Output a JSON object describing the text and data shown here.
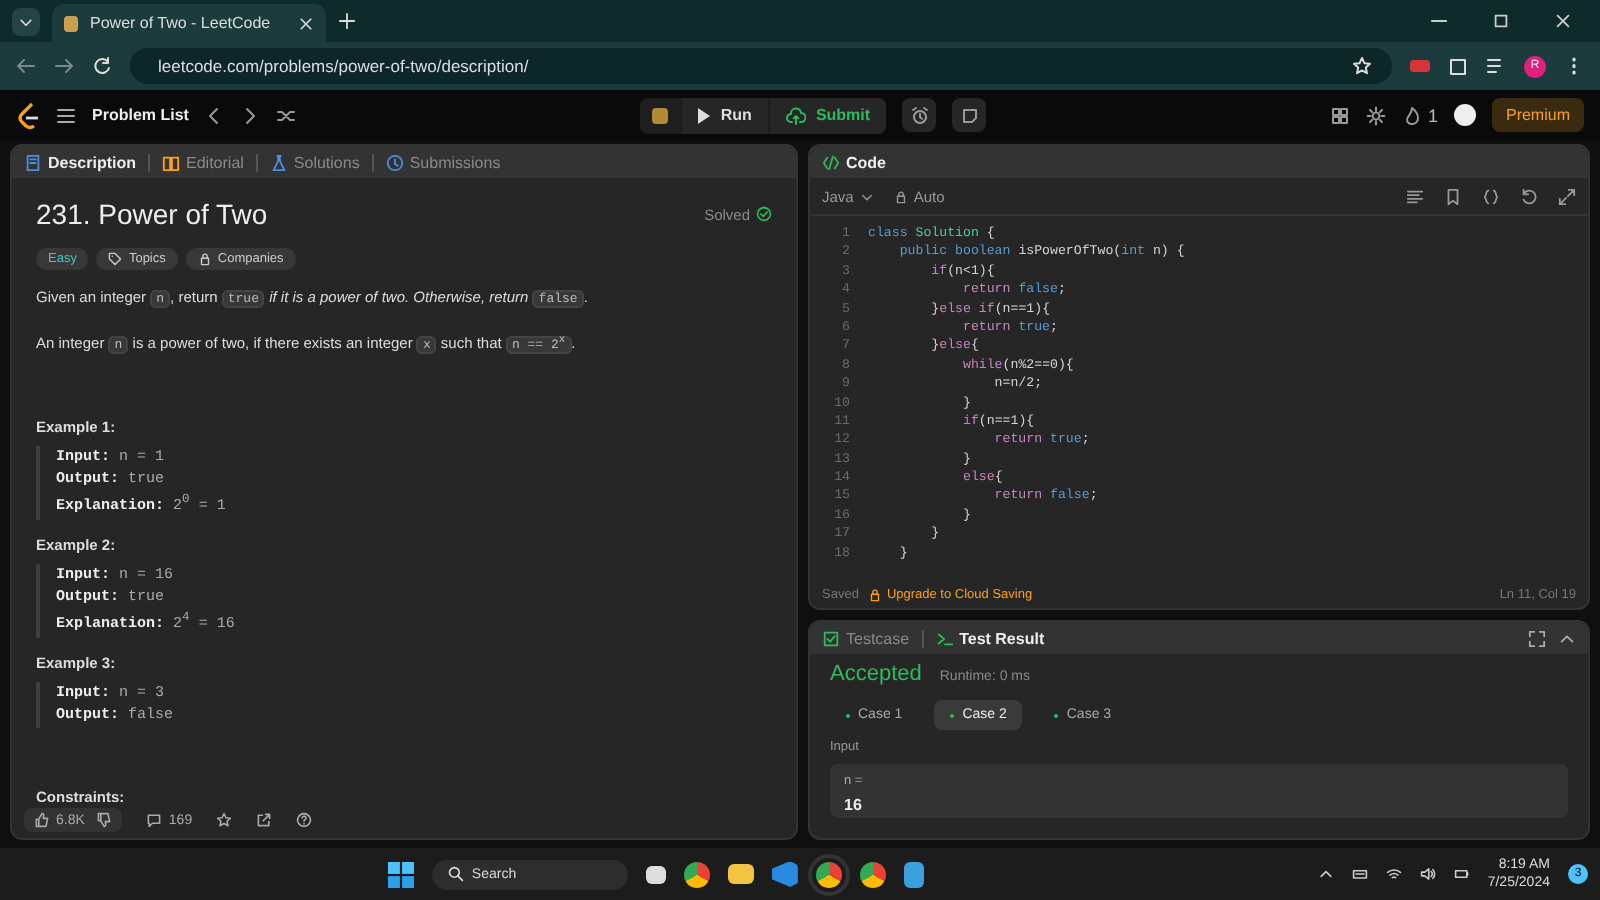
{
  "browser": {
    "tab_title": "Power of Two - LeetCode",
    "url": "leetcode.com/problems/power-of-two/description/",
    "profile_initial": "R"
  },
  "nav": {
    "problem_list": "Problem List",
    "run": "Run",
    "submit": "Submit",
    "streak": "1",
    "premium": "Premium"
  },
  "description_tabs": [
    {
      "label": "Description",
      "selected": true
    },
    {
      "label": "Editorial",
      "selected": false
    },
    {
      "label": "Solutions",
      "selected": false
    },
    {
      "label": "Submissions",
      "selected": false
    }
  ],
  "problem": {
    "title": "231. Power of Two",
    "status": "Solved",
    "difficulty": "Easy",
    "tags": [
      "Topics",
      "Companies"
    ],
    "paragraphs": [
      [
        {
          "kind": "text",
          "text": "Given an integer "
        },
        {
          "kind": "code",
          "text": "n"
        },
        {
          "kind": "text",
          "text": ", return "
        },
        {
          "kind": "code",
          "text": "true"
        },
        {
          "kind": "italic",
          "text": " if it is a power of two. Otherwise, return "
        },
        {
          "kind": "code",
          "text": "false"
        },
        {
          "kind": "text",
          "text": "."
        }
      ],
      [
        {
          "kind": "text",
          "text": "An integer "
        },
        {
          "kind": "code",
          "text": "n"
        },
        {
          "kind": "text",
          "text": " is a power of two, if there exists an integer "
        },
        {
          "kind": "code",
          "text": "x"
        },
        {
          "kind": "text",
          "text": " such that "
        },
        {
          "kind": "code",
          "text": "n == 2$^{x}$"
        },
        {
          "kind": "text",
          "text": "."
        }
      ]
    ],
    "examples": [
      {
        "title": "Example 1:",
        "lines": [
          {
            "label": "Input:",
            "value": "n = 1"
          },
          {
            "label": "Output:",
            "value": "true"
          },
          {
            "label": "Explanation:",
            "value": "2$^{0}$ = 1"
          }
        ]
      },
      {
        "title": "Example 2:",
        "lines": [
          {
            "label": "Input:",
            "value": "n = 16"
          },
          {
            "label": "Output:",
            "value": "true"
          },
          {
            "label": "Explanation:",
            "value": "2$^{4}$ = 16"
          }
        ]
      },
      {
        "title": "Example 3:",
        "lines": [
          {
            "label": "Input:",
            "value": "n = 3"
          },
          {
            "label": "Output:",
            "value": "false"
          }
        ]
      }
    ],
    "constraints_title": "Constraints:",
    "likes": "6.8K",
    "comments": "169"
  },
  "code_panel": {
    "title": "Code",
    "language": "Java",
    "mode": "Auto",
    "saved": "Saved",
    "upgrade": "Upgrade to Cloud Saving",
    "cursor": "Ln 11, Col 19",
    "lines": [
      {
        "number": "1",
        "tokens": [
          {
            "kind": "kw",
            "text": "class "
          },
          {
            "kind": "type",
            "text": "Solution"
          },
          {
            "kind": "plain",
            "text": " {"
          }
        ]
      },
      {
        "number": "2",
        "tokens": [
          {
            "kind": "kw",
            "text": "    public boolean "
          },
          {
            "kind": "plain",
            "text": "isPowerOfTwo("
          },
          {
            "kind": "kw",
            "text": "int"
          },
          {
            "kind": "plain",
            "text": " n) {"
          }
        ]
      },
      {
        "number": "3",
        "tokens": [
          {
            "kind": "ctl",
            "text": "        if"
          },
          {
            "kind": "plain",
            "text": "(n<1){"
          }
        ]
      },
      {
        "number": "4",
        "tokens": [
          {
            "kind": "ctl",
            "text": "            return "
          },
          {
            "kind": "kw",
            "text": "false"
          },
          {
            "kind": "plain",
            "text": ";"
          }
        ]
      },
      {
        "number": "5",
        "tokens": [
          {
            "kind": "plain",
            "text": "        }"
          },
          {
            "kind": "ctl",
            "text": "else if"
          },
          {
            "kind": "plain",
            "text": "(n==1){"
          }
        ]
      },
      {
        "number": "6",
        "tokens": [
          {
            "kind": "ctl",
            "text": "            return "
          },
          {
            "kind": "kw",
            "text": "true"
          },
          {
            "kind": "plain",
            "text": ";"
          }
        ]
      },
      {
        "number": "7",
        "tokens": [
          {
            "kind": "plain",
            "text": "        }"
          },
          {
            "kind": "ctl",
            "text": "else"
          },
          {
            "kind": "plain",
            "text": "{"
          }
        ]
      },
      {
        "number": "8",
        "tokens": [
          {
            "kind": "ctl",
            "text": "            while"
          },
          {
            "kind": "plain",
            "text": "(n%2==0){"
          }
        ]
      },
      {
        "number": "9",
        "tokens": [
          {
            "kind": "plain",
            "text": "                n=n/2;"
          }
        ]
      },
      {
        "number": "10",
        "tokens": [
          {
            "kind": "plain",
            "text": "            }"
          }
        ]
      },
      {
        "number": "11",
        "tokens": [
          {
            "kind": "ctl",
            "text": "            if"
          },
          {
            "kind": "plain",
            "text": "(n==1){"
          }
        ]
      },
      {
        "number": "12",
        "tokens": [
          {
            "kind": "ctl",
            "text": "                return "
          },
          {
            "kind": "kw",
            "text": "true"
          },
          {
            "kind": "plain",
            "text": ";"
          }
        ]
      },
      {
        "number": "13",
        "tokens": [
          {
            "kind": "plain",
            "text": "            }"
          }
        ]
      },
      {
        "number": "14",
        "tokens": [
          {
            "kind": "ctl",
            "text": "            else"
          },
          {
            "kind": "plain",
            "text": "{"
          }
        ]
      },
      {
        "number": "15",
        "tokens": [
          {
            "kind": "ctl",
            "text": "                return "
          },
          {
            "kind": "kw",
            "text": "false"
          },
          {
            "kind": "plain",
            "text": ";"
          }
        ]
      },
      {
        "number": "16",
        "tokens": [
          {
            "kind": "plain",
            "text": "            }"
          }
        ]
      },
      {
        "number": "17",
        "tokens": [
          {
            "kind": "plain",
            "text": "        }"
          }
        ]
      },
      {
        "number": "18",
        "tokens": [
          {
            "kind": "plain",
            "text": "    }"
          }
        ]
      }
    ]
  },
  "result_tabs": [
    {
      "label": "Testcase",
      "selected": false
    },
    {
      "label": "Test Result",
      "selected": true
    }
  ],
  "result": {
    "verdict": "Accepted",
    "runtime": "Runtime: 0 ms",
    "cases": [
      {
        "label": "Case 1",
        "selected": false
      },
      {
        "label": "Case 2",
        "selected": true
      },
      {
        "label": "Case 3",
        "selected": false
      }
    ],
    "input_label": "Input",
    "var_name": "n =",
    "var_value": "16"
  },
  "taskbar": {
    "search": "Search",
    "time": "8:19 AM",
    "date": "7/25/2024",
    "notifications": "3"
  }
}
